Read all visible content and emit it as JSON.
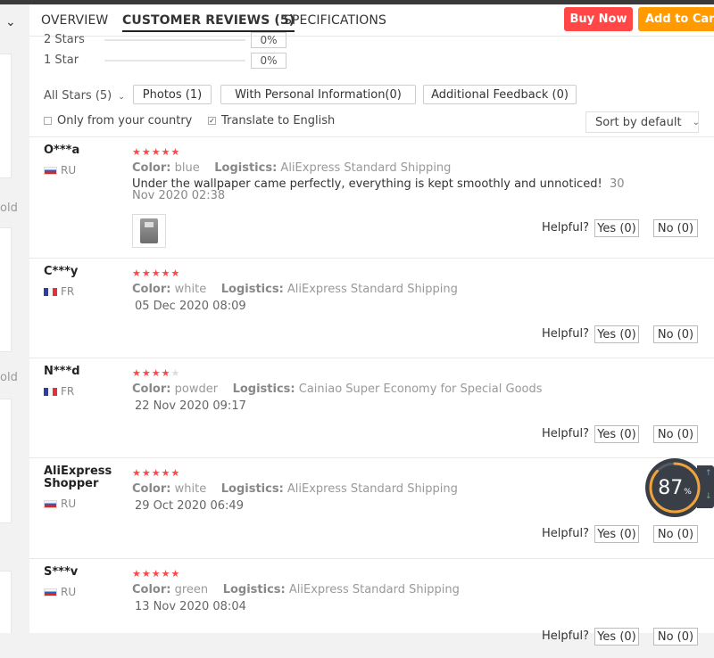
{
  "tabs": [
    {
      "label": "OVERVIEW"
    },
    {
      "label": "CUSTOMER REVIEWS (5)"
    },
    {
      "label": "SPECIFICATIONS"
    }
  ],
  "actions": {
    "buy_now": "Buy Now",
    "add_to_cart": "Add to Cart"
  },
  "left_rail": {
    "snippet_1": "old",
    "snippet_2": "old"
  },
  "ratings": [
    {
      "label": "2 Stars",
      "pct": "0%"
    },
    {
      "label": "1 Star",
      "pct": "0%"
    }
  ],
  "filters": {
    "all_stars": "All Stars (5)",
    "photos": "Photos (1)",
    "personal_info": "With Personal Information(0)",
    "additional_feedback": "Additional Feedback (0)"
  },
  "options": {
    "only_country": "Only from your country",
    "only_country_checked": false,
    "translate": "Translate to English",
    "translate_checked": true,
    "sort": "Sort by default"
  },
  "reviews": [
    {
      "name": "O***a",
      "country": "RU",
      "rating": 5,
      "color_label": "Color:",
      "color": "blue",
      "logistics_label": "Logistics:",
      "logistics": "AliExpress Standard Shipping",
      "text": "Under the wallpaper came perfectly, everything is kept smoothly and unnoticed!",
      "date": "30 Nov 2020 02:38",
      "helpful": "Helpful?",
      "yes": "Yes (0)",
      "no": "No (0)"
    },
    {
      "name": "C***y",
      "country": "FR",
      "rating": 5,
      "color_label": "Color:",
      "color": "white",
      "logistics_label": "Logistics:",
      "logistics": "AliExpress Standard Shipping",
      "date": "05 Dec 2020 08:09",
      "helpful": "Helpful?",
      "yes": "Yes (0)",
      "no": "No (0)"
    },
    {
      "name": "N***d",
      "country": "FR",
      "rating": 4,
      "color_label": "Color:",
      "color": "powder",
      "logistics_label": "Logistics:",
      "logistics": "Cainiao Super Economy for Special Goods",
      "date": "22 Nov 2020 09:17",
      "helpful": "Helpful?",
      "yes": "Yes (0)",
      "no": "No (0)"
    },
    {
      "name": "AliExpress Shopper",
      "country": "RU",
      "rating": 5,
      "color_label": "Color:",
      "color": "white",
      "logistics_label": "Logistics:",
      "logistics": "AliExpress Standard Shipping",
      "date": "29 Oct 2020 06:49",
      "helpful": "Helpful?",
      "yes": "Yes (0)",
      "no": "No (0)"
    },
    {
      "name": "S***v",
      "country": "RU",
      "rating": 5,
      "color_label": "Color:",
      "color": "green",
      "logistics_label": "Logistics:",
      "logistics": "AliExpress Standard Shipping",
      "date": "13 Nov 2020 08:04",
      "helpful": "Helpful?",
      "yes": "Yes (0)",
      "no": "No (0)"
    }
  ],
  "overlay": {
    "value": "87",
    "unit": "%"
  },
  "colors": {
    "buy": "#ff4747",
    "cart": "#ff9a00",
    "star": "#ff4747"
  },
  "icons": [
    "chevron-down-icon",
    "star-icon",
    "flag-ru-icon",
    "flag-fr-icon",
    "checkbox-icon"
  ]
}
